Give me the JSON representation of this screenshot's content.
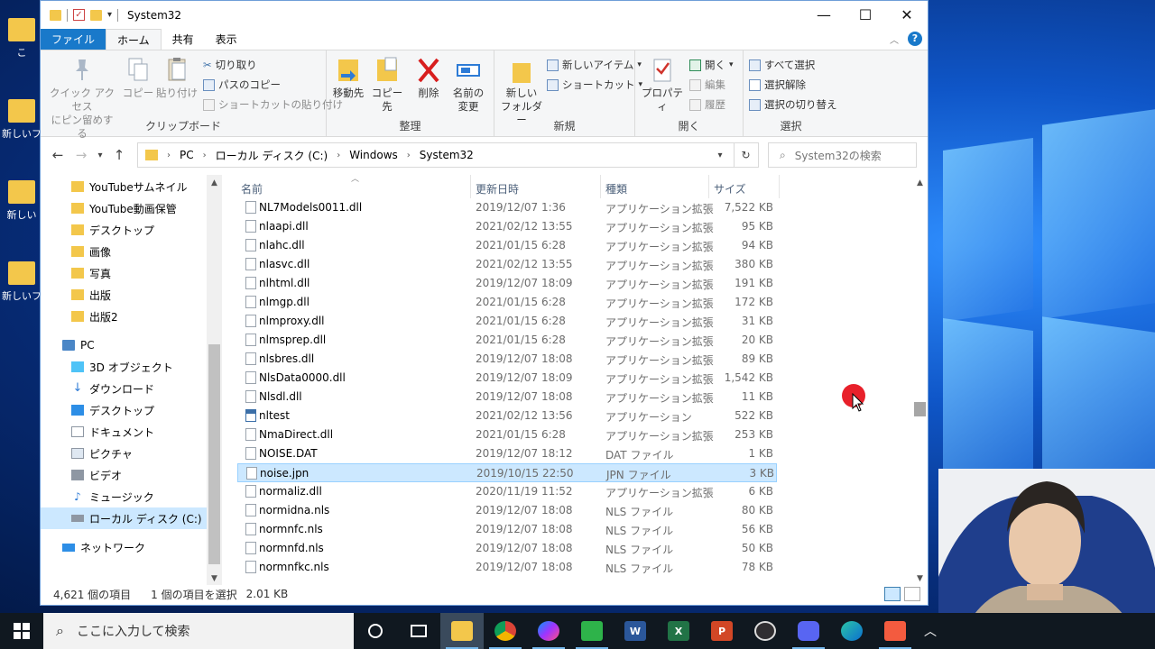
{
  "window": {
    "title": "System32",
    "controls": [
      "minimize",
      "maximize",
      "close"
    ]
  },
  "tabs": {
    "file": "ファイル",
    "home": "ホーム",
    "share": "共有",
    "view": "表示"
  },
  "ribbon": {
    "clipboard": {
      "label": "クリップボード",
      "pin": "クイック アクセス\nにピン留めする",
      "pin_line1": "クイック アクセス",
      "pin_line2": "にピン留めする",
      "copy": "コピー",
      "paste": "貼り付け",
      "cut": "切り取り",
      "copy_path": "パスのコピー",
      "paste_shortcut": "ショートカットの貼り付け"
    },
    "organize": {
      "label": "整理",
      "move_to": "移動先",
      "copy_to": "コピー先",
      "delete": "削除",
      "rename_line1": "名前の",
      "rename_line2": "変更"
    },
    "new": {
      "label": "新規",
      "new_folder_line1": "新しい",
      "new_folder_line2": "フォルダー",
      "new_item": "新しいアイテム",
      "shortcut": "ショートカット"
    },
    "open": {
      "label": "開く",
      "properties": "プロパティ",
      "open": "開く",
      "edit": "編集",
      "history": "履歴"
    },
    "select": {
      "label": "選択",
      "select_all": "すべて選択",
      "select_none": "選択解除",
      "invert": "選択の切り替え"
    }
  },
  "address": {
    "crumbs": [
      "PC",
      "ローカル ディスク (C:)",
      "Windows",
      "System32"
    ],
    "search_placeholder": "System32の検索"
  },
  "nav": {
    "items": [
      {
        "label": "YouTubeサムネイル",
        "icon": "folder-icon"
      },
      {
        "label": "YouTube動画保管",
        "icon": "folder-icon"
      },
      {
        "label": "デスクトップ",
        "icon": "folder-icon"
      },
      {
        "label": "画像",
        "icon": "folder-icon"
      },
      {
        "label": "写真",
        "icon": "folder-icon"
      },
      {
        "label": "出版",
        "icon": "folder-icon"
      },
      {
        "label": "出版2",
        "icon": "folder-icon"
      },
      {
        "label": "PC",
        "icon": "pc-icon"
      },
      {
        "label": "3D オブジェクト",
        "icon": "3d-objects-icon"
      },
      {
        "label": "ダウンロード",
        "icon": "download-icon"
      },
      {
        "label": "デスクトップ",
        "icon": "desktop-icon"
      },
      {
        "label": "ドキュメント",
        "icon": "documents-icon"
      },
      {
        "label": "ピクチャ",
        "icon": "pictures-icon"
      },
      {
        "label": "ビデオ",
        "icon": "videos-icon"
      },
      {
        "label": "ミュージック",
        "icon": "music-icon"
      },
      {
        "label": "ローカル ディスク (C:)",
        "icon": "drive-icon"
      },
      {
        "label": "ネットワーク",
        "icon": "network-icon"
      }
    ]
  },
  "columns": {
    "name": "名前",
    "date": "更新日時",
    "type": "種類",
    "size": "サイズ"
  },
  "files": [
    {
      "name": "NL7Models0011.dll",
      "date": "2019/12/07 1:36",
      "type": "アプリケーション拡張",
      "size": "7,522 KB",
      "kind": "dll"
    },
    {
      "name": "nlaapi.dll",
      "date": "2021/02/12 13:55",
      "type": "アプリケーション拡張",
      "size": "95 KB",
      "kind": "dll"
    },
    {
      "name": "nlahc.dll",
      "date": "2021/01/15 6:28",
      "type": "アプリケーション拡張",
      "size": "94 KB",
      "kind": "dll"
    },
    {
      "name": "nlasvc.dll",
      "date": "2021/02/12 13:55",
      "type": "アプリケーション拡張",
      "size": "380 KB",
      "kind": "dll"
    },
    {
      "name": "nlhtml.dll",
      "date": "2019/12/07 18:09",
      "type": "アプリケーション拡張",
      "size": "191 KB",
      "kind": "dll"
    },
    {
      "name": "nlmgp.dll",
      "date": "2021/01/15 6:28",
      "type": "アプリケーション拡張",
      "size": "172 KB",
      "kind": "dll"
    },
    {
      "name": "nlmproxy.dll",
      "date": "2021/01/15 6:28",
      "type": "アプリケーション拡張",
      "size": "31 KB",
      "kind": "dll"
    },
    {
      "name": "nlmsprep.dll",
      "date": "2021/01/15 6:28",
      "type": "アプリケーション拡張",
      "size": "20 KB",
      "kind": "dll"
    },
    {
      "name": "nlsbres.dll",
      "date": "2019/12/07 18:08",
      "type": "アプリケーション拡張",
      "size": "89 KB",
      "kind": "dll"
    },
    {
      "name": "NlsData0000.dll",
      "date": "2019/12/07 18:09",
      "type": "アプリケーション拡張",
      "size": "1,542 KB",
      "kind": "dll"
    },
    {
      "name": "Nlsdl.dll",
      "date": "2019/12/07 18:08",
      "type": "アプリケーション拡張",
      "size": "11 KB",
      "kind": "dll"
    },
    {
      "name": "nltest",
      "date": "2021/02/12 13:56",
      "type": "アプリケーション",
      "size": "522 KB",
      "kind": "app"
    },
    {
      "name": "NmaDirect.dll",
      "date": "2021/01/15 6:28",
      "type": "アプリケーション拡張",
      "size": "253 KB",
      "kind": "dll"
    },
    {
      "name": "NOISE.DAT",
      "date": "2019/12/07 18:12",
      "type": "DAT ファイル",
      "size": "1 KB",
      "kind": "file"
    },
    {
      "name": "noise.jpn",
      "date": "2019/10/15 22:50",
      "type": "JPN ファイル",
      "size": "3 KB",
      "kind": "file",
      "selected": true
    },
    {
      "name": "normaliz.dll",
      "date": "2020/11/19 11:52",
      "type": "アプリケーション拡張",
      "size": "6 KB",
      "kind": "dll"
    },
    {
      "name": "normidna.nls",
      "date": "2019/12/07 18:08",
      "type": "NLS ファイル",
      "size": "80 KB",
      "kind": "file"
    },
    {
      "name": "normnfc.nls",
      "date": "2019/12/07 18:08",
      "type": "NLS ファイル",
      "size": "56 KB",
      "kind": "file"
    },
    {
      "name": "normnfd.nls",
      "date": "2019/12/07 18:08",
      "type": "NLS ファイル",
      "size": "50 KB",
      "kind": "file"
    },
    {
      "name": "normnfkc.nls",
      "date": "2019/12/07 18:08",
      "type": "NLS ファイル",
      "size": "78 KB",
      "kind": "file"
    }
  ],
  "status": {
    "count": "4,621 個の項目",
    "selection": "1 個の項目を選択",
    "size": "2.01 KB"
  },
  "desktop": {
    "icons": [
      "こ",
      "新しいフ",
      "新しい",
      "新しいフ"
    ]
  },
  "taskbar": {
    "search_placeholder": "ここに入力して検索",
    "apps": [
      "cortana-icon",
      "task-view-icon",
      "file-explorer-icon",
      "chrome-icon",
      "messenger-icon",
      "camtasia-icon",
      "word-icon",
      "excel-icon",
      "powerpoint-icon",
      "obs-icon",
      "discord-icon",
      "edge-icon",
      "app-icon"
    ]
  },
  "colors": {
    "accent": "#1979ca",
    "selection": "#cce8ff",
    "folder": "#f3c74b",
    "cursor_highlight": "#e8202a"
  }
}
